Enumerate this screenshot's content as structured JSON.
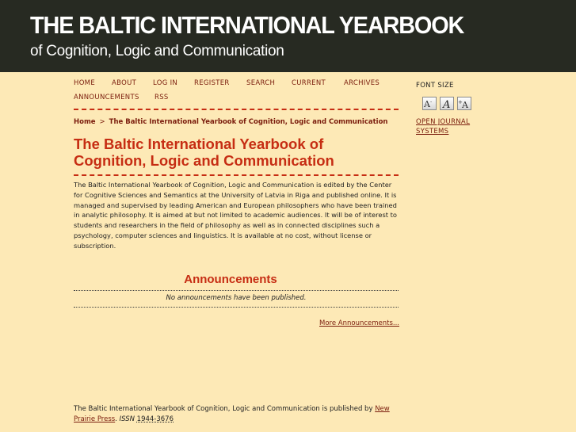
{
  "header": {
    "title": "THE BALTIC INTERNATIONAL YEARBOOK",
    "subtitle": "of Cognition, Logic and Communication"
  },
  "nav": {
    "items": [
      "HOME",
      "ABOUT",
      "LOG IN",
      "REGISTER",
      "SEARCH",
      "CURRENT",
      "ARCHIVES",
      "ANNOUNCEMENTS",
      "RSS"
    ]
  },
  "breadcrumb": {
    "home": "Home",
    "separator": ">",
    "current": "The Baltic International Yearbook of Cognition, Logic and Communication"
  },
  "main": {
    "title_line1": "The Baltic International Yearbook of",
    "title_line2": "Cognition, Logic and Communication",
    "description": "The Baltic International Yearbook of Cognition, Logic and Communication is edited by the Center for Cognitive Sciences and Semantics at the University of Latvia in Riga and published online. It is managed and supervised by leading American and European philosophers who have been trained in analytic philosophy. It is aimed at but not limited to academic audiences. It will be of interest to students and researchers in the field of philosophy as well as in connected disciplines such a psychology, computer sciences and linguistics. It is available at no cost, without license or subscription."
  },
  "announcements": {
    "heading": "Announcements",
    "empty_message": "No announcements have been published.",
    "more_link": "More Announcements..."
  },
  "footer": {
    "text": "The Baltic International Yearbook of Cognition, Logic and Communication is published by",
    "publisher_link": "New Prairie Press",
    "issn_label": "ISSN",
    "issn": "1944-3676"
  },
  "sidebar": {
    "font_size_label": "FONT SIZE",
    "font_buttons": [
      "A-",
      "A",
      "A+"
    ],
    "ojs_link": "OPEN JOURNAL SYSTEMS"
  },
  "colors": {
    "background": "#fde9b6",
    "header_bg": "#272a22",
    "accent": "#c62d13",
    "link": "#7a1c0c"
  }
}
